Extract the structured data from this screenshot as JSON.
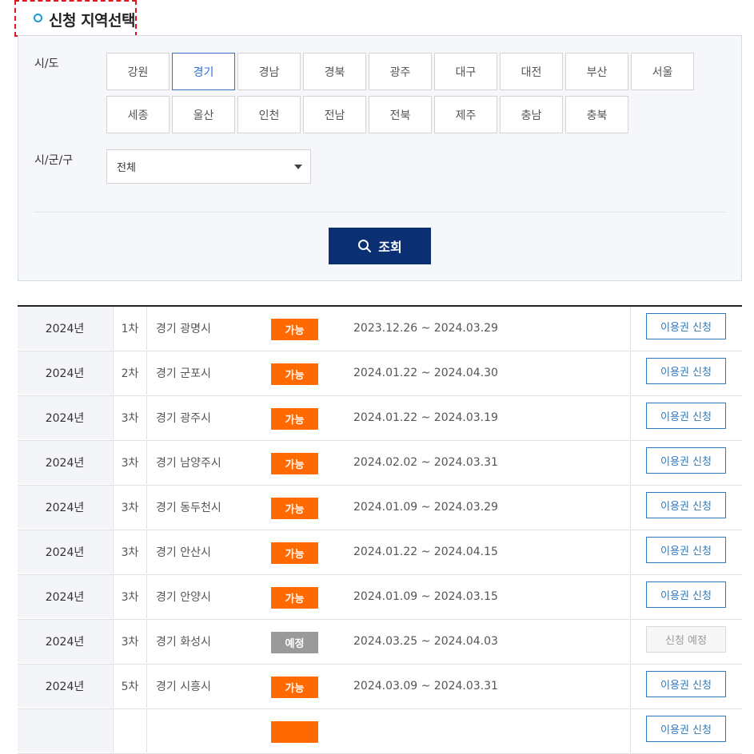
{
  "header": {
    "title": "신청 지역선택"
  },
  "filter": {
    "region_label": "시/도",
    "district_label": "시/군/구",
    "regions_row1": [
      "강원",
      "경기",
      "경남",
      "경북",
      "광주",
      "대구",
      "대전",
      "부산",
      "서울"
    ],
    "regions_row2": [
      "세종",
      "울산",
      "인천",
      "전남",
      "전북",
      "제주",
      "충남",
      "충북"
    ],
    "selected_region": "경기",
    "district_value": "전체",
    "search_label": "조회"
  },
  "table": {
    "rows": [
      {
        "year": "2024년",
        "round": "1차",
        "city": "경기 광명시",
        "status": "가능",
        "status_type": "available",
        "period": "2023.12.26 ~ 2024.03.29",
        "action": "이용권 신청",
        "action_enabled": true
      },
      {
        "year": "2024년",
        "round": "2차",
        "city": "경기 군포시",
        "status": "가능",
        "status_type": "available",
        "period": "2024.01.22 ~ 2024.04.30",
        "action": "이용권 신청",
        "action_enabled": true
      },
      {
        "year": "2024년",
        "round": "3차",
        "city": "경기 광주시",
        "status": "가능",
        "status_type": "available",
        "period": "2024.01.22 ~ 2024.03.19",
        "action": "이용권 신청",
        "action_enabled": true
      },
      {
        "year": "2024년",
        "round": "3차",
        "city": "경기 남양주시",
        "status": "가능",
        "status_type": "available",
        "period": "2024.02.02 ~ 2024.03.31",
        "action": "이용권 신청",
        "action_enabled": true
      },
      {
        "year": "2024년",
        "round": "3차",
        "city": "경기 동두천시",
        "status": "가능",
        "status_type": "available",
        "period": "2024.01.09 ~ 2024.03.29",
        "action": "이용권 신청",
        "action_enabled": true
      },
      {
        "year": "2024년",
        "round": "3차",
        "city": "경기 안산시",
        "status": "가능",
        "status_type": "available",
        "period": "2024.01.22 ~ 2024.04.15",
        "action": "이용권 신청",
        "action_enabled": true
      },
      {
        "year": "2024년",
        "round": "3차",
        "city": "경기 안양시",
        "status": "가능",
        "status_type": "available",
        "period": "2024.01.09 ~ 2024.03.15",
        "action": "이용권 신청",
        "action_enabled": true
      },
      {
        "year": "2024년",
        "round": "3차",
        "city": "경기 화성시",
        "status": "예정",
        "status_type": "scheduled",
        "period": "2024.03.25 ~ 2024.04.03",
        "action": "신청 예정",
        "action_enabled": false
      },
      {
        "year": "2024년",
        "round": "5차",
        "city": "경기 시흥시",
        "status": "가능",
        "status_type": "available",
        "period": "2024.03.09 ~ 2024.03.31",
        "action": "이용권 신청",
        "action_enabled": true
      },
      {
        "year": "",
        "round": "",
        "city": "",
        "status": "",
        "status_type": "available",
        "period": "",
        "action": "이용권 신청",
        "action_enabled": true
      }
    ]
  },
  "colors": {
    "primary": "#0a2f72",
    "available": "#ff6a00",
    "scheduled": "#9a9a9a",
    "link": "#2f7bc6"
  }
}
